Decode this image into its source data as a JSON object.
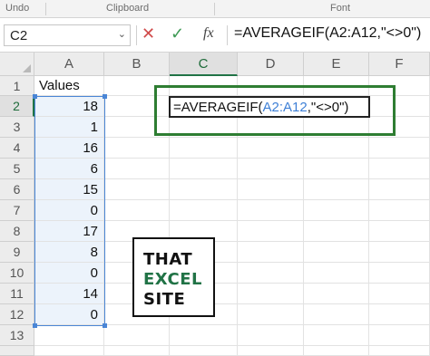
{
  "ribbon": {
    "groups": [
      "Undo",
      "Clipboard",
      "Font"
    ]
  },
  "formula_bar": {
    "name_box": "C2",
    "cancel_icon": "cancel-x-icon",
    "enter_icon": "checkmark-icon",
    "fx_label": "fx",
    "formula": "=AVERAGEIF(A2:A12,\"<>0\")"
  },
  "sheet": {
    "columns": [
      "A",
      "B",
      "C",
      "D",
      "E",
      "F"
    ],
    "selected_column": "C",
    "rows": [
      "1",
      "2",
      "3",
      "4",
      "5",
      "6",
      "7",
      "8",
      "9",
      "10",
      "11",
      "12",
      "13"
    ],
    "selected_row": "2",
    "column_a": {
      "header": "Values",
      "values": [
        "18",
        "1",
        "16",
        "6",
        "15",
        "0",
        "17",
        "8",
        "0",
        "14",
        "0"
      ]
    },
    "editing_cell": {
      "prefix": "=AVERAGEIF(",
      "range_ref": "A2:A12",
      "suffix": ",\"<>0\")"
    },
    "colors": {
      "accent_green": "#217346",
      "range_blue": "#4a86d6"
    }
  },
  "logo": {
    "line1": "THAT",
    "line2": "EXCEL",
    "line3": "SITE"
  }
}
